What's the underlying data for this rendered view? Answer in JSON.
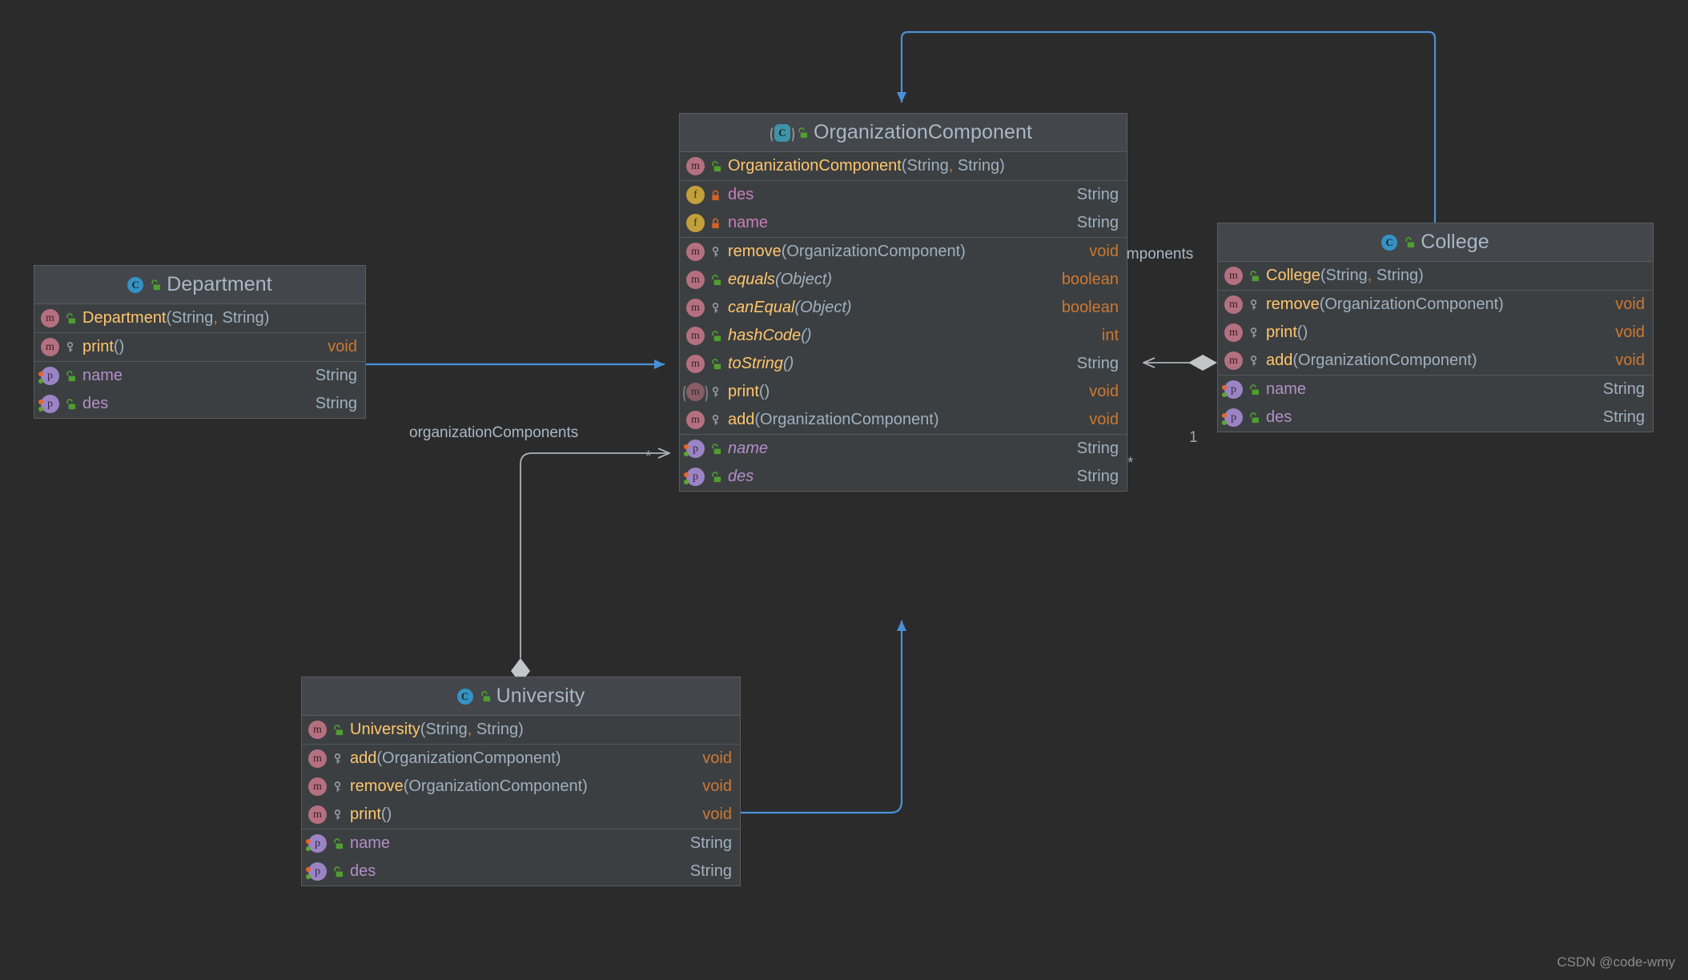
{
  "diagram": {
    "background": "#2b2b2b",
    "card_bg": "#3c3f41",
    "header_bg": "#43464a",
    "inherit_color": "#4a90d9",
    "assoc_color": "#b0b3b5",
    "watermark": "CSDN @code-wmy"
  },
  "classes": {
    "department": {
      "name": "Department",
      "icon": "class-icon",
      "visibility_icon": "unlock-icon",
      "sections": [
        {
          "rows": [
            {
              "kind_icon": "method-icon",
              "access_icon": "unlock-icon",
              "name": "Department",
              "params": "(String, String)",
              "type": "",
              "type_kind": "",
              "italic": false
            }
          ]
        },
        {
          "rows": [
            {
              "kind_icon": "method-icon",
              "access_icon": "key-icon",
              "name": "print",
              "params": "()",
              "type": "void",
              "type_kind": "kw",
              "italic": false
            }
          ]
        },
        {
          "rows": [
            {
              "kind_icon": "property-icon",
              "access_icon": "unlock-icon",
              "name": "name",
              "params": "",
              "type": "String",
              "type_kind": "cls",
              "italic": false
            },
            {
              "kind_icon": "property-icon",
              "access_icon": "unlock-icon",
              "name": "des",
              "params": "",
              "type": "String",
              "type_kind": "cls",
              "italic": false
            }
          ]
        }
      ]
    },
    "organization_component": {
      "name": "OrganizationComponent",
      "icon": "abstract-class-icon",
      "visibility_icon": "unlock-icon",
      "sections": [
        {
          "rows": [
            {
              "kind_icon": "method-icon",
              "access_icon": "unlock-icon",
              "name": "OrganizationComponent",
              "params": "(String, String)",
              "type": "",
              "type_kind": "",
              "italic": false
            }
          ]
        },
        {
          "rows": [
            {
              "kind_icon": "field-icon",
              "access_icon": "lock-icon",
              "name": "des",
              "params": "",
              "type": "String",
              "type_kind": "cls",
              "italic": false
            },
            {
              "kind_icon": "field-icon",
              "access_icon": "lock-icon",
              "name": "name",
              "params": "",
              "type": "String",
              "type_kind": "cls",
              "italic": false
            }
          ]
        },
        {
          "rows": [
            {
              "kind_icon": "method-icon",
              "access_icon": "key-icon",
              "name": "remove",
              "params": "(OrganizationComponent)",
              "type": "void",
              "type_kind": "kw",
              "italic": false
            },
            {
              "kind_icon": "method-icon",
              "access_icon": "unlock-icon",
              "name": "equals",
              "params": "(Object)",
              "type": "boolean",
              "type_kind": "kw",
              "italic": true
            },
            {
              "kind_icon": "method-icon",
              "access_icon": "key-icon",
              "name": "canEqual",
              "params": "(Object)",
              "type": "boolean",
              "type_kind": "kw",
              "italic": true
            },
            {
              "kind_icon": "method-icon",
              "access_icon": "unlock-icon",
              "name": "hashCode",
              "params": "()",
              "type": "int",
              "type_kind": "kw",
              "italic": true
            },
            {
              "kind_icon": "method-icon",
              "access_icon": "unlock-icon",
              "name": "toString",
              "params": "()",
              "type": "String",
              "type_kind": "cls",
              "italic": true
            },
            {
              "kind_icon": "abstract-method-icon",
              "access_icon": "key-icon",
              "name": "print",
              "params": "()",
              "type": "void",
              "type_kind": "kw",
              "italic": false
            },
            {
              "kind_icon": "method-icon",
              "access_icon": "key-icon",
              "name": "add",
              "params": "(OrganizationComponent)",
              "type": "void",
              "type_kind": "kw",
              "italic": false
            }
          ]
        },
        {
          "rows": [
            {
              "kind_icon": "property-icon",
              "access_icon": "unlock-icon",
              "name": "name",
              "params": "",
              "type": "String",
              "type_kind": "cls",
              "italic": true
            },
            {
              "kind_icon": "property-icon",
              "access_icon": "unlock-icon",
              "name": "des",
              "params": "",
              "type": "String",
              "type_kind": "cls",
              "italic": true
            }
          ]
        }
      ]
    },
    "college": {
      "name": "College",
      "icon": "class-icon",
      "visibility_icon": "unlock-icon",
      "sections": [
        {
          "rows": [
            {
              "kind_icon": "method-icon",
              "access_icon": "unlock-icon",
              "name": "College",
              "params": "(String, String)",
              "type": "",
              "type_kind": "",
              "italic": false
            }
          ]
        },
        {
          "rows": [
            {
              "kind_icon": "method-icon",
              "access_icon": "key-icon",
              "name": "remove",
              "params": "(OrganizationComponent)",
              "type": "void",
              "type_kind": "kw",
              "italic": false
            },
            {
              "kind_icon": "method-icon",
              "access_icon": "key-icon",
              "name": "print",
              "params": "()",
              "type": "void",
              "type_kind": "kw",
              "italic": false
            },
            {
              "kind_icon": "method-icon",
              "access_icon": "key-icon",
              "name": "add",
              "params": "(OrganizationComponent)",
              "type": "void",
              "type_kind": "kw",
              "italic": false
            }
          ]
        },
        {
          "rows": [
            {
              "kind_icon": "property-icon",
              "access_icon": "unlock-icon",
              "name": "name",
              "params": "",
              "type": "String",
              "type_kind": "cls",
              "italic": false
            },
            {
              "kind_icon": "property-icon",
              "access_icon": "unlock-icon",
              "name": "des",
              "params": "",
              "type": "String",
              "type_kind": "cls",
              "italic": false
            }
          ]
        }
      ]
    },
    "university": {
      "name": "University",
      "icon": "class-icon",
      "visibility_icon": "unlock-icon",
      "sections": [
        {
          "rows": [
            {
              "kind_icon": "method-icon",
              "access_icon": "unlock-icon",
              "name": "University",
              "params": "(String, String)",
              "type": "",
              "type_kind": "",
              "italic": false
            }
          ]
        },
        {
          "rows": [
            {
              "kind_icon": "method-icon",
              "access_icon": "key-icon",
              "name": "add",
              "params": "(OrganizationComponent)",
              "type": "void",
              "type_kind": "kw",
              "italic": false
            },
            {
              "kind_icon": "method-icon",
              "access_icon": "key-icon",
              "name": "remove",
              "params": "(OrganizationComponent)",
              "type": "void",
              "type_kind": "kw",
              "italic": false
            },
            {
              "kind_icon": "method-icon",
              "access_icon": "key-icon",
              "name": "print",
              "params": "()",
              "type": "void",
              "type_kind": "kw",
              "italic": false
            }
          ]
        },
        {
          "rows": [
            {
              "kind_icon": "property-icon",
              "access_icon": "unlock-icon",
              "name": "name",
              "params": "",
              "type": "String",
              "type_kind": "cls",
              "italic": false
            },
            {
              "kind_icon": "property-icon",
              "access_icon": "unlock-icon",
              "name": "des",
              "params": "",
              "type": "String",
              "type_kind": "cls",
              "italic": false
            }
          ]
        }
      ]
    }
  },
  "edges": {
    "university_assoc_label": "organizationComponents",
    "university_assoc_mult": "*",
    "college_assoc_label": "organizationComponents",
    "college_assoc_mult_target": "*",
    "college_assoc_mult_source": "1"
  }
}
